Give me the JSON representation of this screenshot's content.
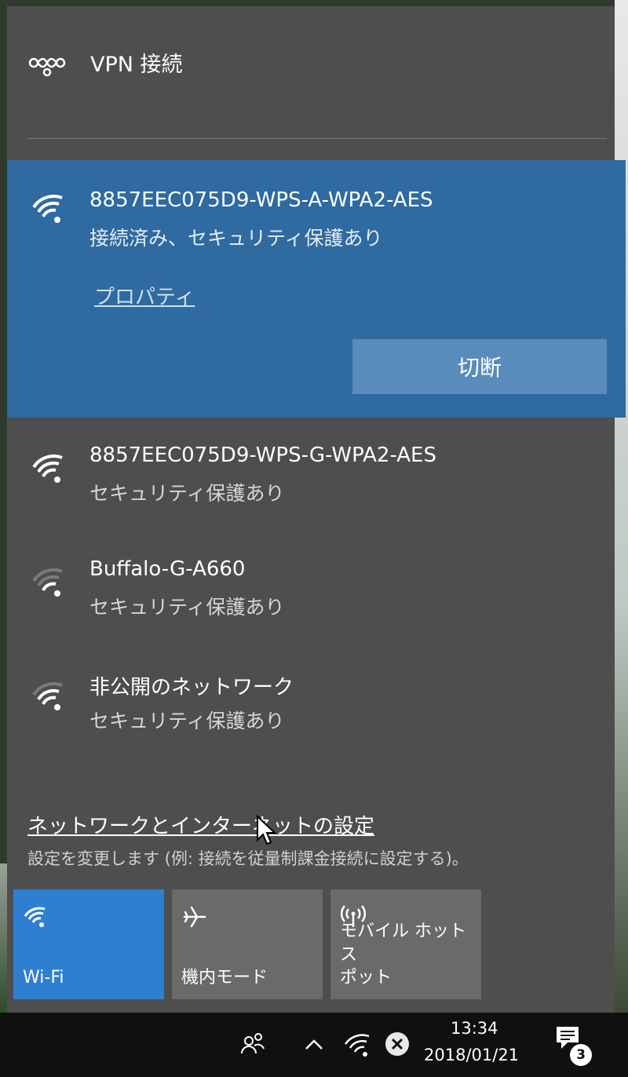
{
  "vpn": {
    "label": "VPN 接続",
    "icon": "vpn-icon"
  },
  "networks": [
    {
      "name": "8857EEC075D9-WPS-A-WPA2-AES",
      "status": "接続済み、セキュリティ保護あり",
      "signal_bars": 4,
      "selected": true
    },
    {
      "name": "8857EEC075D9-WPS-G-WPA2-AES",
      "status": "セキュリティ保護あり",
      "signal_bars": 4,
      "selected": false
    },
    {
      "name": "Buffalo-G-A660",
      "status": "セキュリティ保護あり",
      "signal_bars": 2,
      "selected": false
    },
    {
      "name": "非公開のネットワーク",
      "status": "セキュリティ保護あり",
      "signal_bars": 3,
      "selected": false
    }
  ],
  "selected_actions": {
    "properties_link": "プロパティ",
    "disconnect_button": "切断"
  },
  "settings": {
    "link": "ネットワークとインターネットの設定",
    "description": "設定を変更します (例: 接続を従量制課金接続に設定する)。"
  },
  "quick_actions": [
    {
      "label": "Wi-Fi",
      "icon": "wifi-icon",
      "active": true
    },
    {
      "label": "機内モード",
      "icon": "airplane-icon",
      "active": false
    },
    {
      "label": "モバイル ホットス\nポット",
      "icon": "hotspot-icon",
      "active": false
    }
  ],
  "taskbar": {
    "time": "13:34",
    "date": "2018/01/21",
    "notification_count": "3",
    "icons": [
      "people-icon",
      "chevron-up-icon",
      "wifi-icon",
      "volume-muted-icon",
      "action-center-icon"
    ]
  },
  "colors": {
    "flyout_bg": "#4e4e4e",
    "selected_bg": "#2f6aa0",
    "accent": "#2f7fd0",
    "taskbar_bg": "#101010"
  }
}
